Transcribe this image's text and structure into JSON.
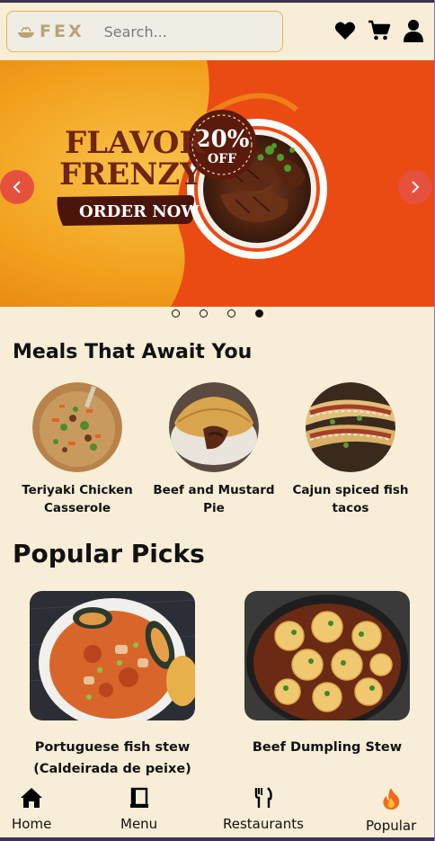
{
  "header": {
    "logo_text": "FEX",
    "search_placeholder": "Search...",
    "icons": [
      "heart-icon",
      "cart-icon",
      "user-icon"
    ]
  },
  "banner": {
    "line1": "FLAVOR",
    "line2": "FRENZY",
    "cta": "ORDER NOW",
    "badge_value": "20%",
    "badge_suffix": "OFF",
    "slide_count": 4,
    "active_slide": 4
  },
  "meals_section": {
    "title": "Meals That Await You",
    "items": [
      {
        "name": "Teriyaki Chicken Casserole"
      },
      {
        "name": "Beef and Mustard Pie"
      },
      {
        "name": "Cajun spiced fish tacos"
      }
    ]
  },
  "popular_section": {
    "title": "Popular Picks",
    "items": [
      {
        "name": "Portuguese fish stew (Caldeirada de peixe)"
      },
      {
        "name": "Beef Dumpling Stew"
      }
    ]
  },
  "nav": {
    "items": [
      {
        "label": "Home",
        "icon": "home-icon"
      },
      {
        "label": "Menu",
        "icon": "menu-icon"
      },
      {
        "label": "Restaurants",
        "icon": "restaurants-icon"
      },
      {
        "label": "Popular",
        "icon": "fire-icon"
      }
    ]
  },
  "colors": {
    "background": "#f8edd6",
    "accent": "#e6513e",
    "banner_orange": "#f2a11d",
    "banner_red": "#ea4b13",
    "brown": "#5a1a0c"
  }
}
